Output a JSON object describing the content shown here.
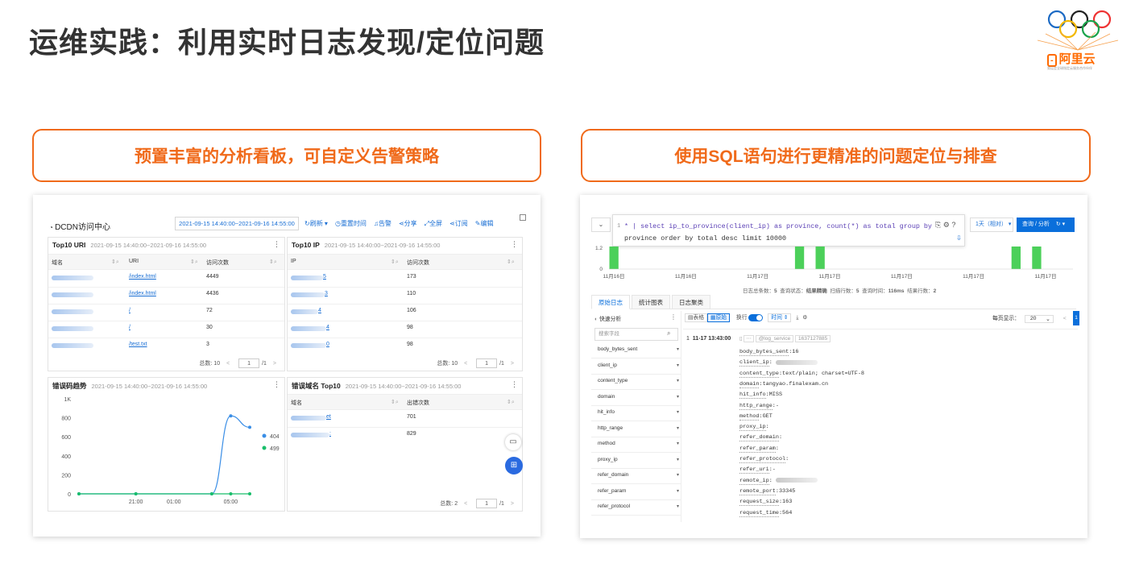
{
  "slide": {
    "title": "运维实践：利用实时日志发现/定位问题",
    "logo_text": "阿里云",
    "logo_tagline": "奥运会全球指定云服务合作伙伴",
    "left_banner": "预置丰富的分析看板，可自定义告警策略",
    "right_banner": "使用SQL语句进行更精准的问题定位与排查"
  },
  "colors": {
    "accent": "#f06a1a",
    "link": "#1a6fd4",
    "series_404": "#3a8ee6",
    "series_499": "#19be6b"
  },
  "dashboard": {
    "title": "DCDN访问中心",
    "time_range": "2021-09-15 14:40:00~2021-09-16 14:55:00",
    "toolbar": {
      "refresh": "刷新",
      "reset_time": "重置时间",
      "alert": "告警",
      "share": "分享",
      "fullscreen": "全屏",
      "subscribe": "订阅",
      "edit": "编辑"
    },
    "panel_uri": {
      "title": "Top10 URI",
      "time": "2021-09-15 14:40:00~2021-09-16 14:55:00",
      "columns": [
        "域名",
        "URI",
        "访问次数"
      ],
      "rows": [
        {
          "uri": "/index.html",
          "count": "4449"
        },
        {
          "uri": "/index.html",
          "count": "4436"
        },
        {
          "uri": "/",
          "count": "72"
        },
        {
          "uri": "/",
          "count": "30"
        },
        {
          "uri": "/test.txt",
          "count": "3"
        }
      ],
      "pager": {
        "total_label": "总数:",
        "total": "10",
        "page": "1",
        "pages": "/1"
      }
    },
    "panel_ip": {
      "title": "Top10 IP",
      "time": "2021-09-15 14:40:00~2021-09-16 14:55:00",
      "columns": [
        "IP",
        "访问次数"
      ],
      "rows": [
        {
          "suffix": "5",
          "count": "173"
        },
        {
          "suffix": "3",
          "count": "110"
        },
        {
          "suffix": "4",
          "count": "106"
        },
        {
          "suffix": "4",
          "count": "98"
        },
        {
          "suffix": "0",
          "count": "98"
        }
      ],
      "pager": {
        "total_label": "总数:",
        "total": "10",
        "page": "1",
        "pages": "/1"
      }
    },
    "panel_trend": {
      "title": "错误码趋势",
      "time": "2021-09-15 14:40:00~2021-09-16 14:55:00"
    },
    "panel_domain": {
      "title": "错误域名 Top10",
      "time": "2021-09-15 14:40:00~2021-09-16 14:55:00",
      "columns": [
        "域名",
        "出错次数"
      ],
      "rows": [
        {
          "suffix": "et",
          "count": "701"
        },
        {
          "suffix": ":",
          "count": "829"
        }
      ],
      "pager": {
        "total_label": "总数:",
        "total": "2",
        "page": "1",
        "pages": "/1"
      }
    }
  },
  "chart_data": {
    "type": "line",
    "title": "错误码趋势",
    "x_ticks": [
      "21:00",
      "01:00",
      "05:00"
    ],
    "y_ticks": [
      "0",
      "200",
      "400",
      "600",
      "800",
      "1K"
    ],
    "ylim": [
      0,
      1000
    ],
    "x": [
      0,
      1,
      2,
      3,
      4,
      5,
      6,
      7,
      8,
      9
    ],
    "series": [
      {
        "name": "404",
        "values": [
          0,
          0,
          0,
          0,
          0,
          0,
          0,
          0,
          820,
          700
        ]
      },
      {
        "name": "499",
        "values": [
          0,
          0,
          0,
          0,
          0,
          0,
          0,
          0,
          0,
          0
        ]
      }
    ],
    "legend": "right"
  },
  "logpage": {
    "sql_line_numbers": [
      "1"
    ],
    "sql_line1": "* | select ip_to_province(client_ip) as province, count(*) as total group by",
    "sql_line2": "province order by total desc limit 10000",
    "time_select": "1天（相对）",
    "query_button": "查询 / 分析",
    "histogram": {
      "y_ticks": [
        "1.2",
        "0"
      ],
      "x_ticks": [
        "11月16日",
        "11月16日",
        "11月17日",
        "11月17日",
        "11月17日",
        "11月17日",
        "11月17日"
      ],
      "bars": [
        1,
        0,
        0,
        0,
        0,
        0,
        0,
        0,
        0,
        0,
        0,
        0,
        0,
        0,
        0,
        0,
        0,
        0,
        1,
        0,
        1,
        0,
        0,
        0,
        0,
        0,
        0,
        0,
        0,
        0,
        0,
        0,
        0,
        0,
        0,
        0,
        0,
        0,
        0,
        1,
        0,
        1,
        0,
        0,
        0
      ]
    },
    "stats": {
      "total_label": "日志总条数：",
      "total": "5",
      "status_label": "查询状态：",
      "status": "结果精确",
      "rows_label": "扫描行数：",
      "rows": "5",
      "time_label": "查询时间：",
      "time": "116ms",
      "result_label": "结果行数：",
      "result": "2"
    },
    "tabs": [
      "原始日志",
      "统计图表",
      "日志聚类"
    ],
    "quick_analysis": "快速分析",
    "search_field_placeholder": "搜索字段",
    "view_table": "表格",
    "view_raw": "原始",
    "wrap_label": "换行",
    "time_sort": "时间",
    "per_page_label": "每页显示：",
    "per_page": "20",
    "page": "1",
    "fields": [
      "body_bytes_sent",
      "client_ip",
      "content_type",
      "domain",
      "hit_info",
      "http_range",
      "method",
      "proxy_ip",
      "refer_domain",
      "refer_param",
      "refer_protocol"
    ],
    "log_index": "1",
    "log_time": "11-17 13:43:00",
    "log_source": "@log_service",
    "log_ts": "1637127885",
    "log_entries": [
      {
        "k": "body_bytes_sent",
        "v": ":16"
      },
      {
        "k": "client_ip",
        "v": ":"
      },
      {
        "k": "content_type",
        "v": ":text/plain; charset=UTF-8"
      },
      {
        "k": "domain",
        "v": ":tangyao.finalexam.cn"
      },
      {
        "k": "hit_info",
        "v": ":MISS"
      },
      {
        "k": "http_range",
        "v": ":-"
      },
      {
        "k": "method",
        "v": ":GET"
      },
      {
        "k": "proxy_ip",
        "v": ":"
      },
      {
        "k": "refer_domain",
        "v": ":"
      },
      {
        "k": "refer_param",
        "v": ":"
      },
      {
        "k": "refer_protocol",
        "v": ":"
      },
      {
        "k": "refer_uri",
        "v": ":-"
      },
      {
        "k": "remote_ip",
        "v": ":"
      },
      {
        "k": "remote_port",
        "v": ":33345"
      },
      {
        "k": "request_size",
        "v": ":163"
      },
      {
        "k": "request_time",
        "v": ":564"
      }
    ]
  }
}
